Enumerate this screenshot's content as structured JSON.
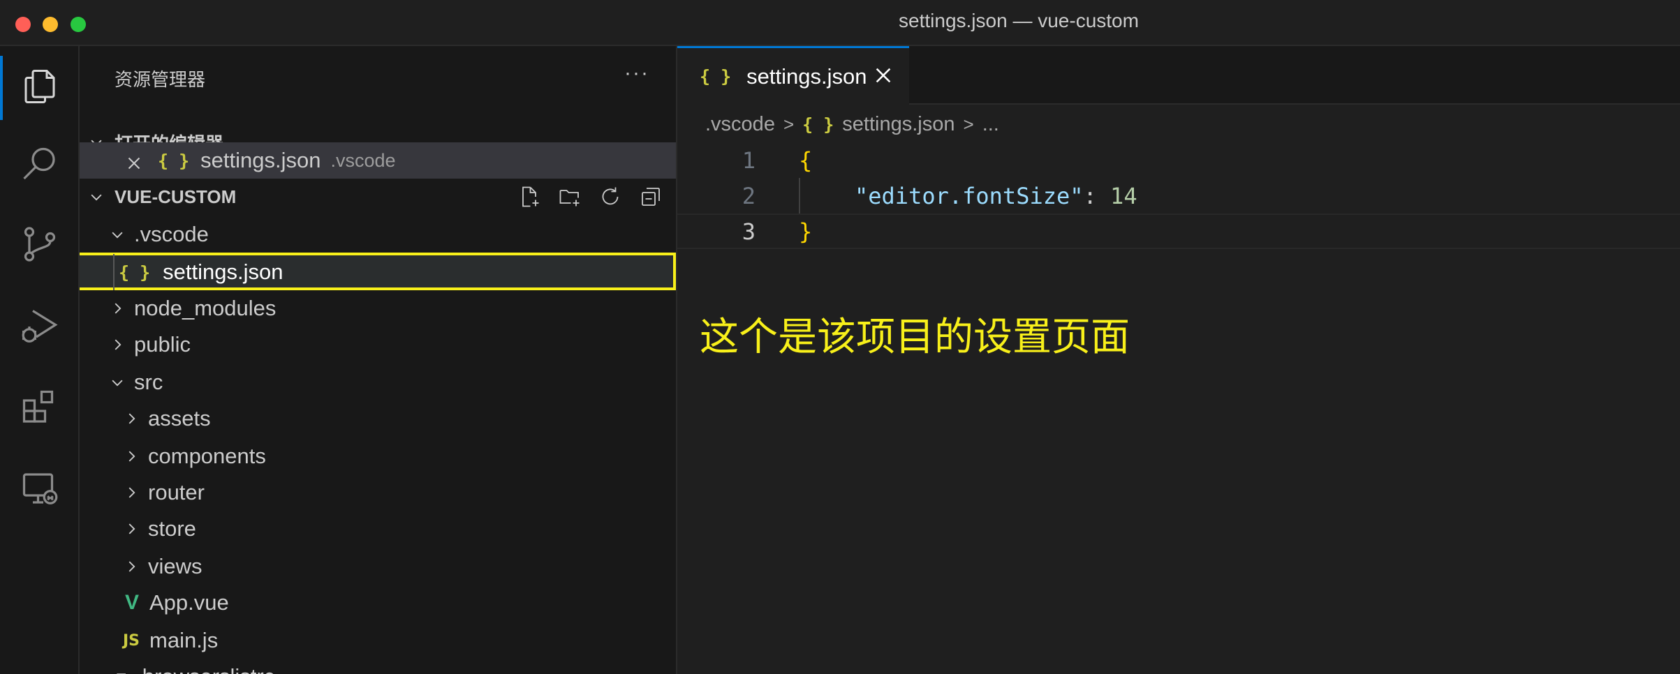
{
  "window": {
    "title": "settings.json — vue-custom"
  },
  "activity_bar": {
    "items": [
      {
        "name": "explorer",
        "icon": "files-icon",
        "active": true
      },
      {
        "name": "search",
        "icon": "search-icon"
      },
      {
        "name": "source-control",
        "icon": "source-control-icon"
      },
      {
        "name": "run-debug",
        "icon": "run-debug-icon"
      },
      {
        "name": "extensions",
        "icon": "extensions-icon"
      },
      {
        "name": "remote-explorer",
        "icon": "remote-explorer-icon"
      }
    ]
  },
  "sidebar": {
    "title": "资源管理器",
    "more": "···",
    "open_editors": {
      "title": "打开的编辑器",
      "items": [
        {
          "icon": "{ }",
          "name": "settings.json",
          "folder": ".vscode"
        }
      ]
    },
    "project": {
      "title": "VUE-CUSTOM",
      "tree": {
        "vscode": ".vscode",
        "settings": "settings.json",
        "node_modules": "node_modules",
        "public": "public",
        "src": "src",
        "assets": "assets",
        "components": "components",
        "router": "router",
        "store": "store",
        "views": "views",
        "app_vue": "App.vue",
        "main_js": "main.js",
        "browserslistrc": ".browserslistrc"
      },
      "icons": {
        "json": "{ }",
        "vue": "V",
        "js": "JS"
      }
    }
  },
  "editor": {
    "tab": {
      "icon": "{ }",
      "label": "settings.json"
    },
    "breadcrumb": {
      "folder": ".vscode",
      "icon": "{ }",
      "file": "settings.json",
      "sep": ">",
      "more": "..."
    },
    "lines": [
      {
        "no": "1",
        "open": "{"
      },
      {
        "no": "2",
        "key": "\"editor.fontSize\"",
        "colon": ": ",
        "value": "14"
      },
      {
        "no": "3",
        "close": "}"
      }
    ],
    "annotation": "这个是该项目的设置页面"
  },
  "colors": {
    "accent": "#0078d4",
    "highlight": "#f8f01a",
    "json_icon": "#cbcb41"
  }
}
